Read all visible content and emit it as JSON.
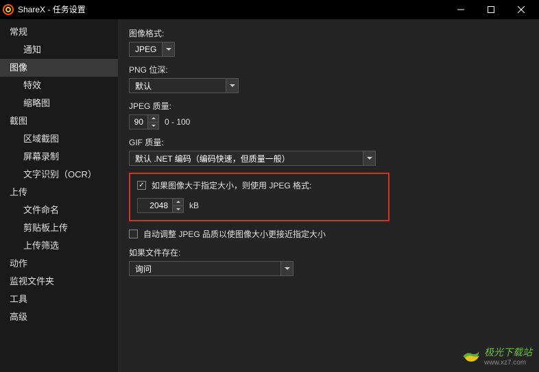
{
  "window": {
    "title": "ShareX - 任务设置"
  },
  "sidebar": {
    "items": [
      {
        "label": "常规",
        "level": 0
      },
      {
        "label": "通知",
        "level": 1
      },
      {
        "label": "图像",
        "level": 0,
        "selected": true
      },
      {
        "label": "特效",
        "level": 1
      },
      {
        "label": "缩略图",
        "level": 1
      },
      {
        "label": "截图",
        "level": 0
      },
      {
        "label": "区域截图",
        "level": 1
      },
      {
        "label": "屏幕录制",
        "level": 1
      },
      {
        "label": "文字识别（OCR）",
        "level": 1
      },
      {
        "label": "上传",
        "level": 0
      },
      {
        "label": "文件命名",
        "level": 1
      },
      {
        "label": "剪贴板上传",
        "level": 1
      },
      {
        "label": "上传筛选",
        "level": 1
      },
      {
        "label": "动作",
        "level": 0
      },
      {
        "label": "监视文件夹",
        "level": 0
      },
      {
        "label": "工具",
        "level": 0
      },
      {
        "label": "高级",
        "level": 0
      }
    ]
  },
  "content": {
    "image_format_label": "图像格式:",
    "image_format_value": "JPEG",
    "png_depth_label": "PNG 位深:",
    "png_depth_value": "默认",
    "jpeg_quality_label": "JPEG 质量:",
    "jpeg_quality_value": "90",
    "jpeg_quality_range": "0 - 100",
    "gif_quality_label": "GIF 质量:",
    "gif_quality_value": "默认 .NET 编码（编码快速，但质量一般）",
    "use_jpeg_checkbox_label": "如果图像大于指定大小，则使用 JPEG 格式:",
    "size_value": "2048",
    "size_unit": "kB",
    "auto_adjust_label": "自动调整 JPEG 品质以使图像大小更接近指定大小",
    "file_exists_label": "如果文件存在:",
    "file_exists_value": "询问"
  },
  "watermark": {
    "main": "极光下载站",
    "sub": "www.xz7.com"
  }
}
